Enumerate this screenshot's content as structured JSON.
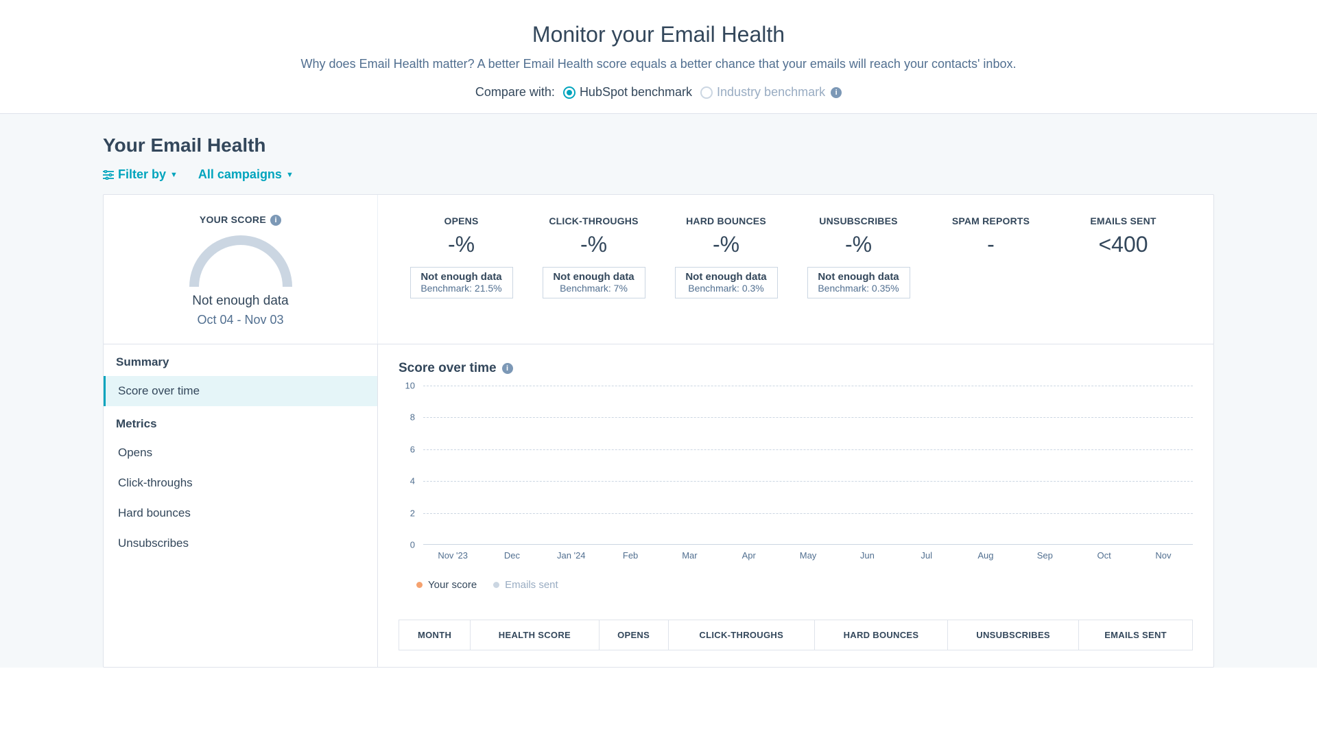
{
  "top": {
    "title": "Monitor your Email Health",
    "subtitle": "Why does Email Health matter? A better Email Health score equals a better chance that your emails will reach your contacts' inbox.",
    "compare_label": "Compare with:",
    "options": {
      "hubspot": "HubSpot benchmark",
      "industry": "Industry benchmark"
    }
  },
  "section_title": "Your Email Health",
  "filters": {
    "filter_by": "Filter by",
    "campaigns": "All campaigns"
  },
  "score_panel": {
    "label": "YOUR SCORE",
    "status": "Not enough data",
    "date_range": "Oct 04 - Nov 03"
  },
  "stats": [
    {
      "label": "OPENS",
      "value": "-%",
      "box_line1": "Not enough data",
      "box_line2": "Benchmark: 21.5%"
    },
    {
      "label": "CLICK-THROUGHS",
      "value": "-%",
      "box_line1": "Not enough data",
      "box_line2": "Benchmark: 7%"
    },
    {
      "label": "HARD BOUNCES",
      "value": "-%",
      "box_line1": "Not enough data",
      "box_line2": "Benchmark: 0.3%"
    },
    {
      "label": "UNSUBSCRIBES",
      "value": "-%",
      "box_line1": "Not enough data",
      "box_line2": "Benchmark: 0.35%"
    },
    {
      "label": "SPAM REPORTS",
      "value": "-"
    },
    {
      "label": "EMAILS SENT",
      "value": "<400"
    }
  ],
  "nav": {
    "group1": "Summary",
    "item_score_over_time": "Score over time",
    "group2": "Metrics",
    "items": [
      "Opens",
      "Click-throughs",
      "Hard bounces",
      "Unsubscribes"
    ]
  },
  "chart_title": "Score over time",
  "chart_data": {
    "type": "line",
    "title": "Score over time",
    "xlabel": "",
    "ylabel": "",
    "ylim": [
      0,
      10
    ],
    "y_ticks": [
      10,
      8,
      6,
      4,
      2,
      0
    ],
    "categories": [
      "Nov '23",
      "Dec",
      "Jan '24",
      "Feb",
      "Mar",
      "Apr",
      "May",
      "Jun",
      "Jul",
      "Aug",
      "Sep",
      "Oct",
      "Nov"
    ],
    "series": [
      {
        "name": "Your score",
        "values": [
          null,
          null,
          null,
          null,
          null,
          null,
          null,
          null,
          null,
          null,
          null,
          null,
          null
        ],
        "color": "#f5a26f"
      },
      {
        "name": "Emails sent",
        "values": [
          null,
          null,
          null,
          null,
          null,
          null,
          null,
          null,
          null,
          null,
          null,
          null,
          null
        ],
        "color": "#cbd6e2"
      }
    ]
  },
  "table_headers": [
    "MONTH",
    "HEALTH SCORE",
    "OPENS",
    "CLICK-THROUGHS",
    "HARD BOUNCES",
    "UNSUBSCRIBES",
    "EMAILS SENT"
  ]
}
